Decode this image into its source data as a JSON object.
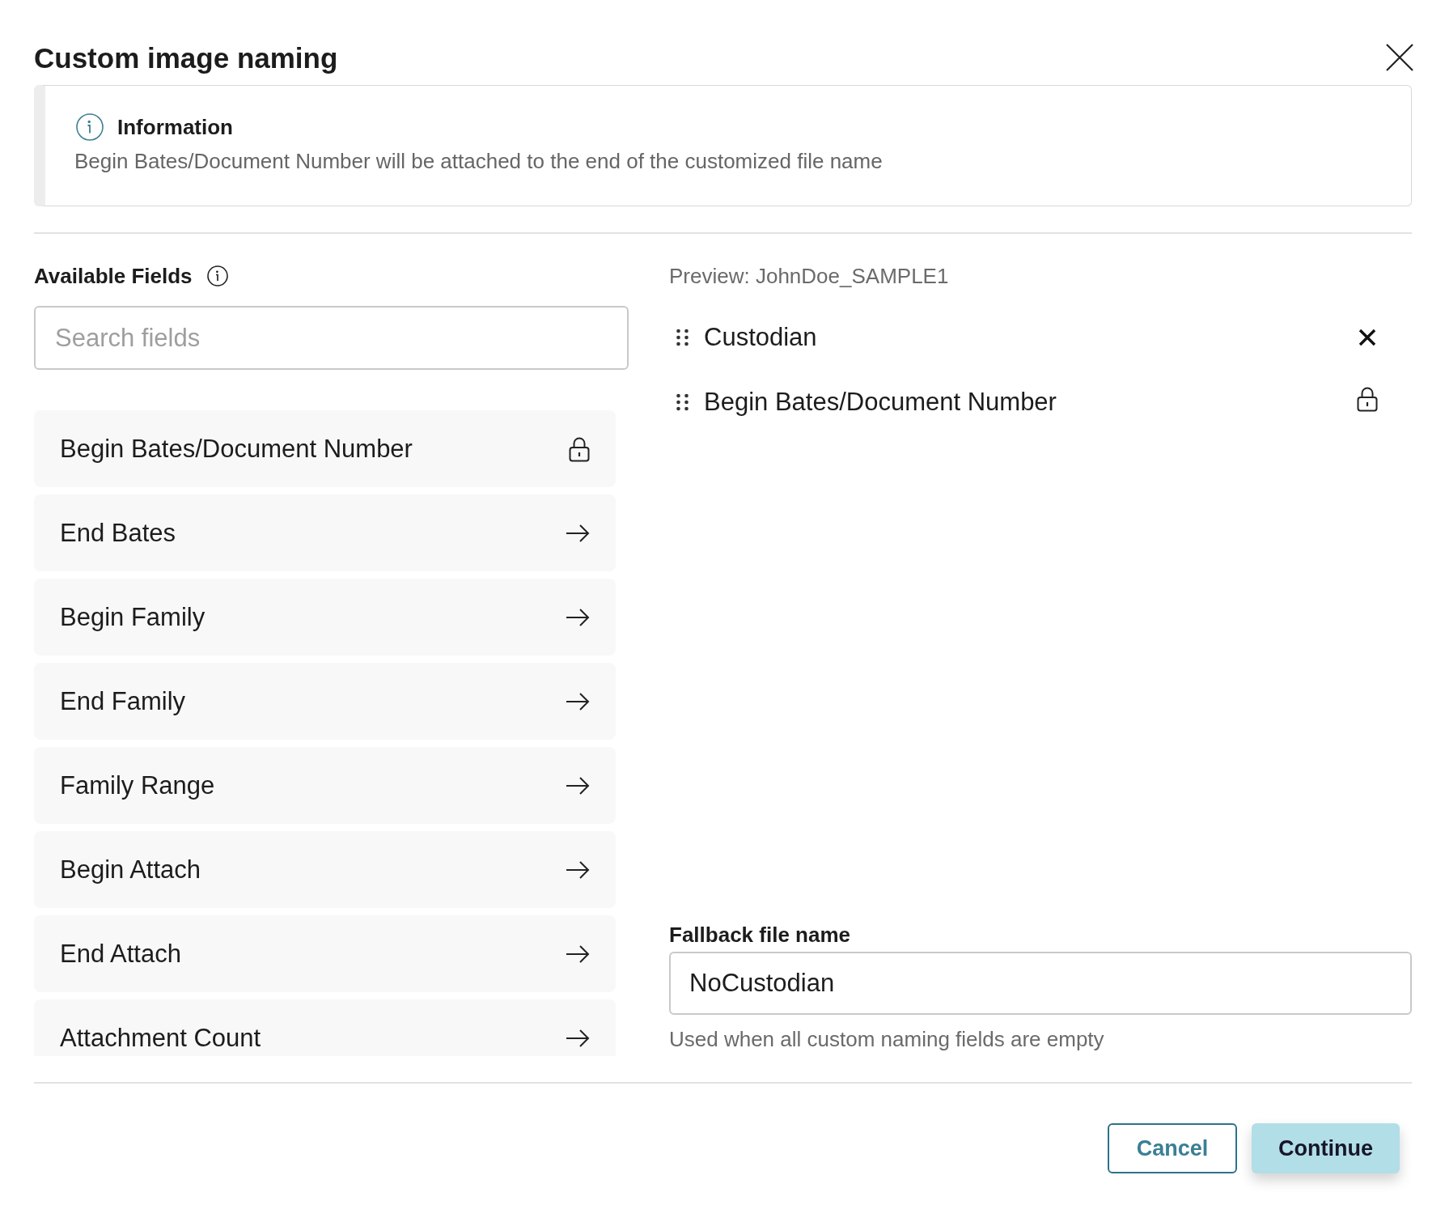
{
  "dialog": {
    "title": "Custom image naming"
  },
  "info_banner": {
    "title": "Information",
    "message": "Begin Bates/Document Number will be attached to the end of the customized file name"
  },
  "available_fields": {
    "heading": "Available Fields",
    "search": {
      "placeholder": "Search fields"
    },
    "items": [
      {
        "label": "Begin Bates/Document Number",
        "locked": true
      },
      {
        "label": "End Bates",
        "locked": false
      },
      {
        "label": "Begin Family",
        "locked": false
      },
      {
        "label": "End Family",
        "locked": false
      },
      {
        "label": "Family Range",
        "locked": false
      },
      {
        "label": "Begin Attach",
        "locked": false
      },
      {
        "label": "End Attach",
        "locked": false
      },
      {
        "label": "Attachment Count",
        "locked": false
      }
    ]
  },
  "preview": {
    "text": "Preview: JohnDoe_SAMPLE1",
    "selected_fields": [
      {
        "label": "Custodian",
        "locked": false
      },
      {
        "label": "Begin Bates/Document Number",
        "locked": true
      }
    ]
  },
  "fallback": {
    "label": "Fallback file name",
    "value": "NoCustodian",
    "help": "Used when all custom naming fields are empty"
  },
  "buttons": [
    {
      "label": "Cancel",
      "kind": "secondary"
    },
    {
      "label": "Continue",
      "kind": "primary"
    }
  ]
}
